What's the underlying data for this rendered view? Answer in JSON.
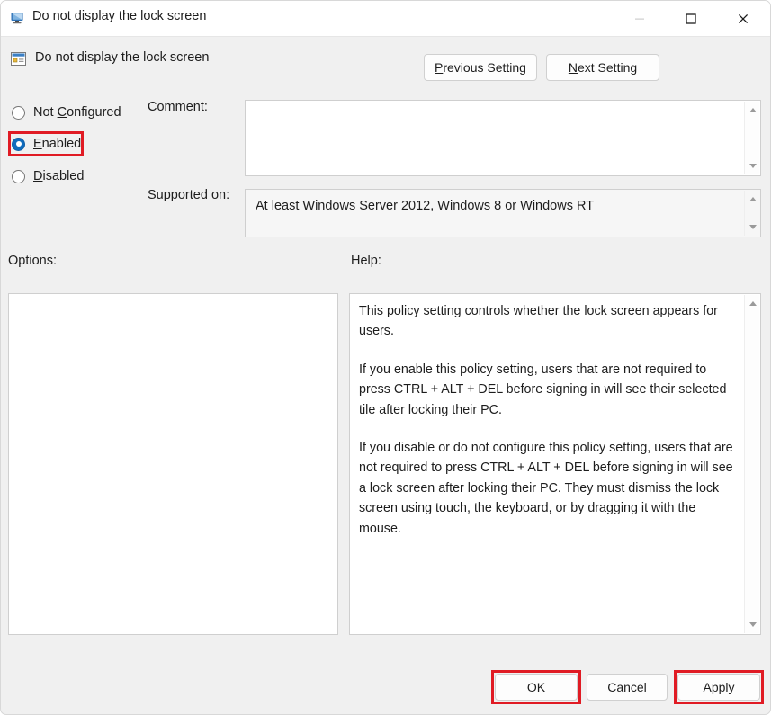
{
  "window": {
    "title": "Do not display the lock screen",
    "icon": "computer-monitor-icon",
    "controls": {
      "minimize": "minimize-icon",
      "maximize": "maximize-icon",
      "close": "close-icon"
    }
  },
  "header": {
    "policy_icon": "group-policy-setting-icon",
    "policy_name": "Do not display the lock screen",
    "previous_setting": {
      "accel": "P",
      "rest": "revious Setting"
    },
    "next_setting": {
      "accel": "N",
      "rest": "ext Setting"
    }
  },
  "state": {
    "options": [
      {
        "id": "not-configured",
        "accel_pre": "Not ",
        "accel": "C",
        "accel_post": "onfigured",
        "selected": false
      },
      {
        "id": "enabled",
        "accel_pre": "",
        "accel": "E",
        "accel_post": "nabled",
        "selected": true
      },
      {
        "id": "disabled",
        "accel_pre": "",
        "accel": "D",
        "accel_post": "isabled",
        "selected": false
      }
    ]
  },
  "fields": {
    "comment_label": "Comment:",
    "comment_value": "",
    "supported_label": "Supported on:",
    "supported_value": "At least Windows Server 2012, Windows 8 or Windows RT"
  },
  "panels": {
    "options_label": "Options:",
    "options_content": "",
    "help_label": "Help:",
    "help_paragraphs": [
      "This policy setting controls whether the lock screen appears for users.",
      "If you enable this policy setting, users that are not required to press CTRL + ALT + DEL before signing in will see their selected tile after locking their PC.",
      "If you disable or do not configure this policy setting, users that are not required to press CTRL + ALT + DEL before signing in will see a lock screen after locking their PC. They must dismiss the lock screen using touch, the keyboard, or by dragging it with the mouse."
    ]
  },
  "footer": {
    "ok": "OK",
    "cancel": "Cancel",
    "apply": {
      "accel": "A",
      "rest": "pply"
    }
  },
  "highlights": {
    "color": "#e01b24",
    "targets": [
      "enabled-radio",
      "ok-button",
      "apply-button"
    ]
  }
}
